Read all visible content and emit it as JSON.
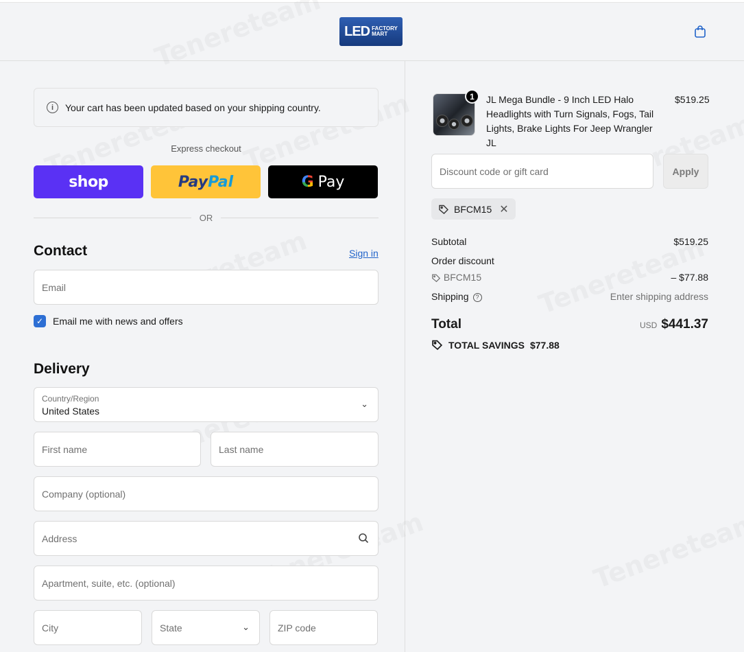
{
  "header": {
    "logo_big": "LED",
    "logo_small_1": "FACTORY",
    "logo_small_2": "MART"
  },
  "notice": {
    "text": "Your cart has been updated based on your shipping country."
  },
  "express": {
    "label": "Express checkout",
    "shop_label": "shop",
    "paypal_label_1": "Pay",
    "paypal_label_2": "Pal",
    "gpay_g": "G",
    "gpay_label": "Pay",
    "or_label": "OR"
  },
  "contact": {
    "heading": "Contact",
    "signin_label": "Sign in",
    "email_placeholder": "Email",
    "newsletter_label": "Email me with news and offers",
    "newsletter_checked": true
  },
  "delivery": {
    "heading": "Delivery",
    "country_label": "Country/Region",
    "country_value": "United States",
    "first_name_placeholder": "First name",
    "last_name_placeholder": "Last name",
    "company_placeholder": "Company (optional)",
    "address_placeholder": "Address",
    "apartment_placeholder": "Apartment, suite, etc. (optional)",
    "city_placeholder": "City",
    "state_placeholder": "State",
    "zip_placeholder": "ZIP code"
  },
  "order": {
    "product_title": "JL Mega Bundle - 9 Inch LED Halo Headlights with Turn Signals, Fogs, Tail Lights, Brake Lights For Jeep Wrangler JL",
    "product_qty": "1",
    "product_price": "$519.25",
    "discount_placeholder": "Discount code or gift card",
    "apply_label": "Apply",
    "applied_code": "BFCM15",
    "subtotal_label": "Subtotal",
    "subtotal_value": "$519.25",
    "order_discount_label": "Order discount",
    "discount_code": "BFCM15",
    "discount_value": "– $77.88",
    "shipping_label": "Shipping",
    "shipping_value": "Enter shipping address",
    "total_label": "Total",
    "currency": "USD",
    "total_value": "$441.37",
    "savings_label": "TOTAL SAVINGS",
    "savings_value": "$77.88"
  },
  "colors": {
    "shop": "#5a31f4",
    "paypal": "#ffc439",
    "gpay": "#000000",
    "link": "#1f62c9",
    "checkbox": "#2d6fd4"
  }
}
